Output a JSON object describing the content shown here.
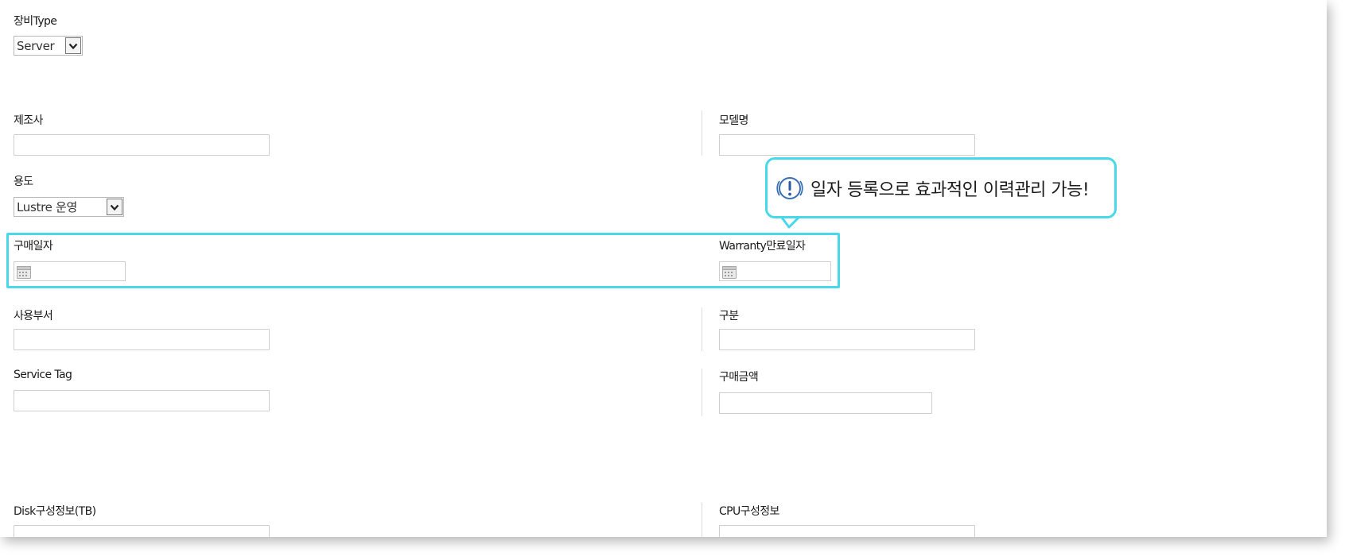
{
  "form": {
    "equipment_type": {
      "label": "장비Type",
      "value": "Server"
    },
    "manufacturer": {
      "label": "제조사",
      "value": ""
    },
    "model_name": {
      "label": "모델명",
      "value": ""
    },
    "purpose": {
      "label": "용도",
      "value": "Lustre 운영"
    },
    "purchase_date": {
      "label": "구매일자",
      "value": ""
    },
    "warranty_end_date": {
      "label": "Warranty만료일자",
      "value": ""
    },
    "user_department": {
      "label": "사용부서",
      "value": ""
    },
    "category": {
      "label": "구분",
      "value": ""
    },
    "service_tag": {
      "label": "Service Tag",
      "value": ""
    },
    "purchase_amount": {
      "label": "구매금액",
      "value": ""
    },
    "disk_config": {
      "label": "Disk구성정보(TB)",
      "value": ""
    },
    "cpu_config": {
      "label": "CPU구성정보",
      "value": ""
    }
  },
  "callout": {
    "text": "일자 등록으로 효과적인 이력관리 가능!",
    "icon": "alert-circle-icon"
  },
  "colors": {
    "highlight": "#47d9ea",
    "border": "#cfcfcf"
  }
}
